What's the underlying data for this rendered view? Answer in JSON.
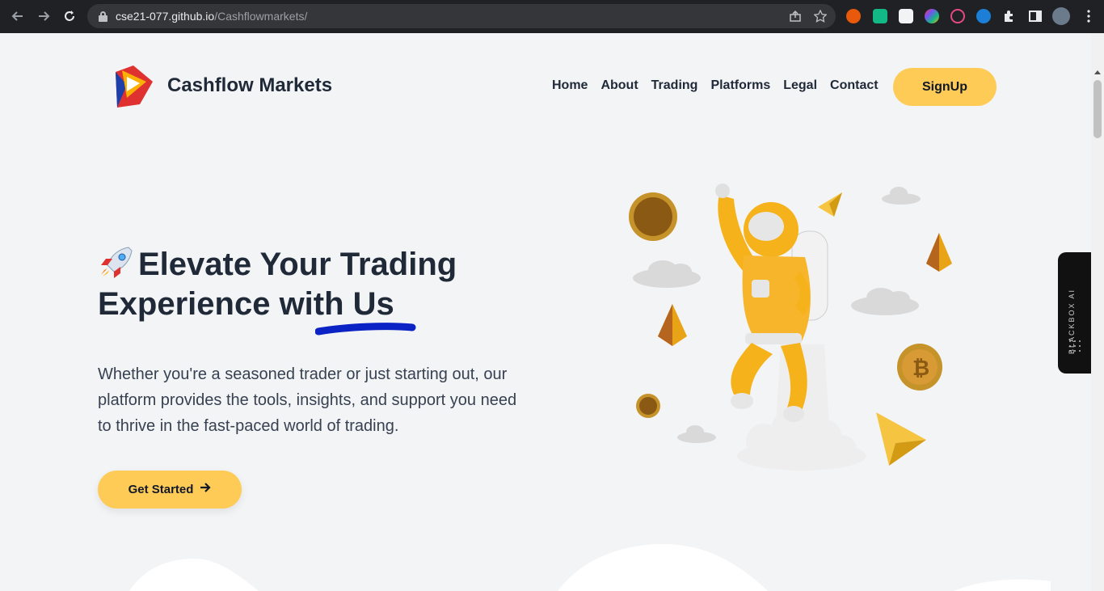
{
  "browser": {
    "url_host": "cse21-077.github.io",
    "url_path": "/Cashflowmarkets/"
  },
  "header": {
    "brand": "Cashflow Markets",
    "nav": [
      "Home",
      "About",
      "Trading",
      "Platforms",
      "Legal",
      "Contact"
    ],
    "signup_label": "SignUp"
  },
  "hero": {
    "headline_line1": "Elevate Your Trading",
    "headline_line2": "Experience with Us",
    "description": "Whether you're a seasoned trader or just starting out, our platform provides the tools, insights, and support you need to thrive in the fast-paced world of trading.",
    "cta_label": "Get Started"
  },
  "sidebar_widget": {
    "label": "BLACKBOX AI"
  },
  "colors": {
    "accent": "#fecb57",
    "text": "#1f2937",
    "underline": "#0b22c4",
    "page_bg": "#f3f4f6"
  }
}
